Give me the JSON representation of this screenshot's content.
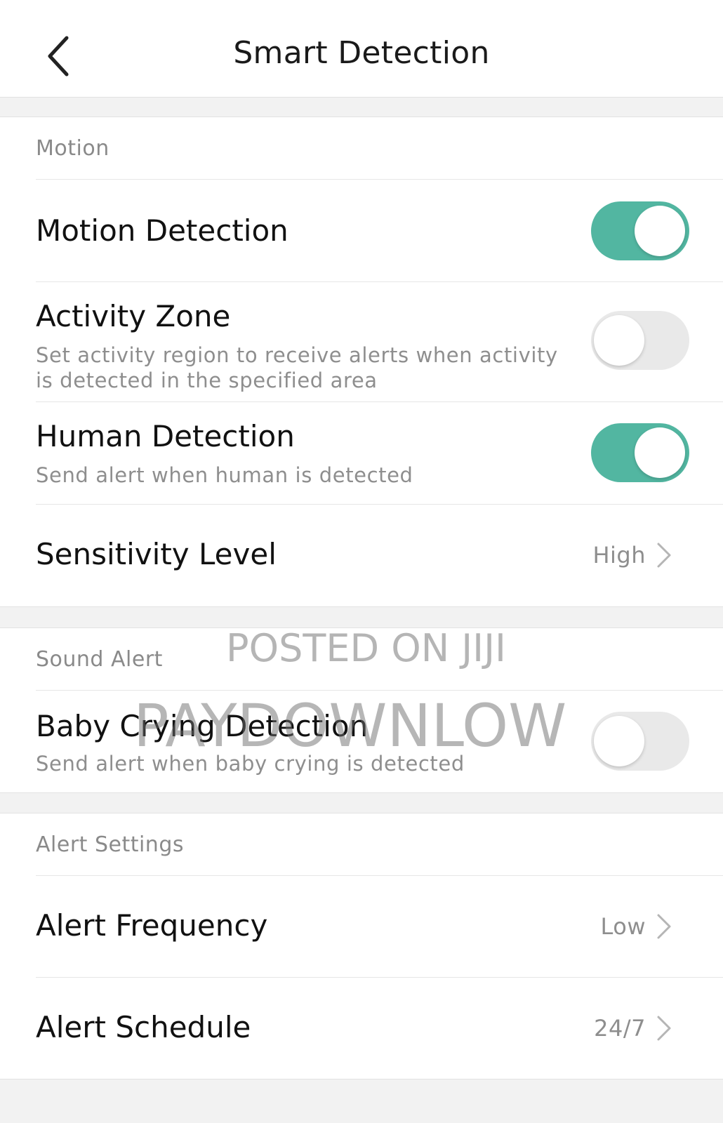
{
  "header": {
    "title": "Smart Detection",
    "back_icon": "chevron-left-icon"
  },
  "motion": {
    "section_label": "Motion",
    "motion_detection": {
      "title": "Motion Detection",
      "toggle": "on"
    },
    "activity_zone": {
      "title": "Activity Zone",
      "subtitle_line1": "Set activity region to receive alerts when activity",
      "subtitle_line2": "is detected in the specified area",
      "toggle": "off"
    },
    "human_detection": {
      "title": "Human Detection",
      "subtitle": "Send alert when human is detected",
      "toggle": "on"
    },
    "sensitivity": {
      "title": "Sensitivity Level",
      "value": "High"
    }
  },
  "sound": {
    "section_label": "Sound Alert",
    "baby_crying": {
      "title": "Baby Crying Detection",
      "subtitle": "Send alert when baby crying is detected",
      "toggle": "off"
    }
  },
  "alerts": {
    "section_label": "Alert Settings",
    "frequency": {
      "title": "Alert Frequency",
      "value": "Low"
    },
    "schedule": {
      "title": "Alert Schedule",
      "value": "24/7"
    }
  },
  "watermark": {
    "line1": "POSTED ON JIJI",
    "line2": "PAYDOWNLOW"
  },
  "colors": {
    "toggle_on": "#52b6a1",
    "toggle_off": "#e9e9e9",
    "background": "#f2f2f2"
  }
}
